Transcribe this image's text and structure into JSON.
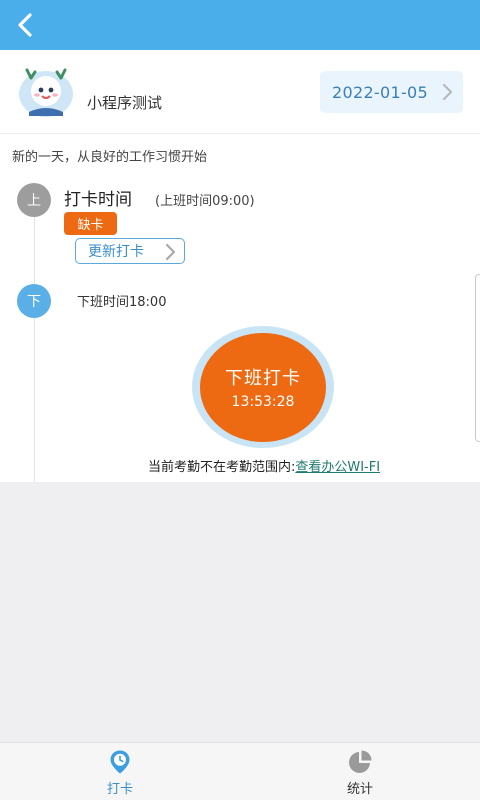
{
  "header": {
    "back_icon": "back-chevron-icon"
  },
  "profile": {
    "app_name": "小程序测试",
    "avatar_icon": "mascot-avatar",
    "date": "2022-01-05",
    "date_chevron_icon": "chevron-right-icon"
  },
  "motto": "新的一天，从良好的工作习惯开始",
  "clock_in": {
    "node_label": "上",
    "title": "打卡时间",
    "subtitle": "(上班时间09:00)",
    "status_badge": "缺卡",
    "update_label": "更新打卡"
  },
  "clock_out": {
    "node_label": "下",
    "time_label": "下班时间18:00",
    "button_label": "下班打卡",
    "button_time": "13:53:28"
  },
  "range_note": {
    "text": "当前考勤不在考勤范围内:",
    "link": "查看办公WI-FI"
  },
  "tabs": [
    {
      "label": "打卡",
      "icon": "clock-pin-icon",
      "active": true
    },
    {
      "label": "统计",
      "icon": "pie-chart-icon",
      "active": false
    }
  ],
  "colors": {
    "header": "#4aaeea",
    "accent_orange": "#ee6a12",
    "accent_blue": "#3a8fc9",
    "link": "#1e7a6d"
  }
}
